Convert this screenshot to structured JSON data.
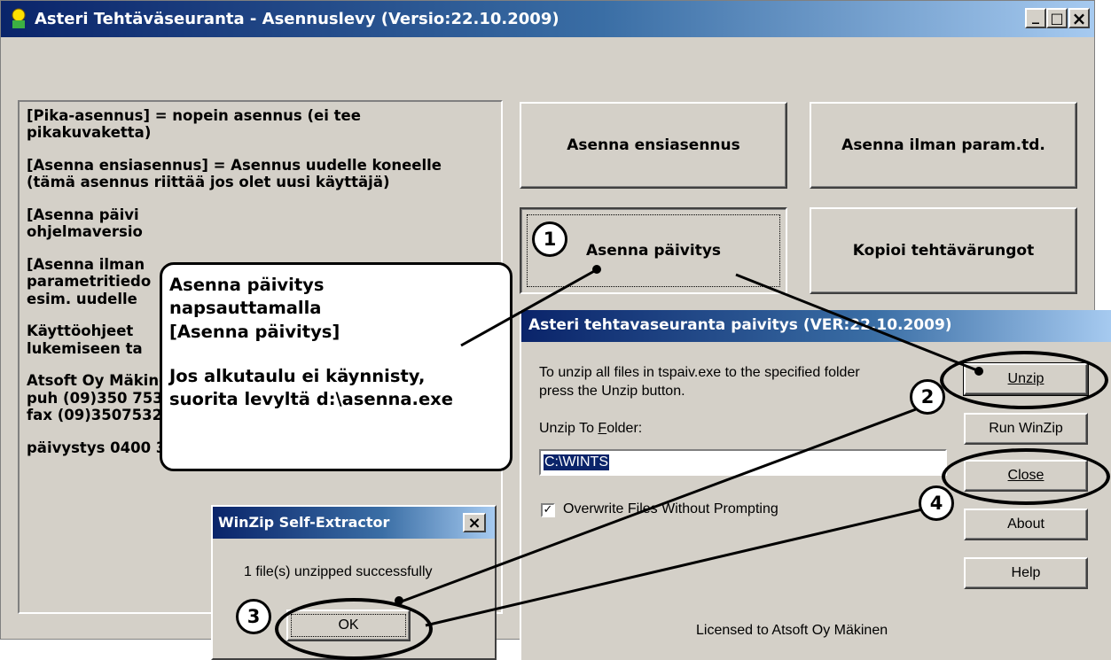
{
  "main_window": {
    "title": "Asteri Tehtäväseuranta - Asennuslevy (Versio:22.10.2009)"
  },
  "info_panel": {
    "lines": [
      "[Pika-asennus] = nopein asennus (ei tee pikakuvaketta)",
      "[Asenna ensiasennus] = Asennus uudelle koneelle (tämä asennus riittää jos olet uusi käyttäjä)",
      "[Asenna päivi",
      "ohjelmaversio",
      "[Asenna ilman",
      "parametritiedo",
      "esim. uudelle",
      "Käyttöohjeet",
      "lukemiseen ta",
      "Atsoft Oy Mäkinen - www.atsoft.fi",
      "puh (09)350 7530",
      "fax (09)35075321",
      "päivystys 0400 316"
    ]
  },
  "buttons": {
    "ensiasennus": "Asenna ensiasennus",
    "ilman_param": "Asenna ilman param.td.",
    "paivitys": "Asenna päivitys",
    "kopioi": "Kopioi tehtävärungot"
  },
  "callout": {
    "line1": "Asenna päivitys",
    "line2": "napsauttamalla",
    "line3": "[Asenna päivitys]",
    "line4": "Jos alkutaulu ei käynnisty,",
    "line5": "suorita levyltä d:\\asenna.exe"
  },
  "winzip": {
    "title": "Asteri tehtavaseuranta paivitys (VER:22.10.2009)",
    "instruction_1": "To unzip all files in tspaiv.exe to the specified folder",
    "instruction_2": "press the Unzip button.",
    "folder_label": "Unzip To Folder:",
    "folder_value": "C:\\WINTS",
    "overwrite_label": "Overwrite Files Without Prompting",
    "overwrite_checked": true,
    "btn_unzip": "Unzip",
    "btn_run_winzip": "Run WinZip",
    "btn_close": "Close",
    "btn_about": "About",
    "btn_help": "Help",
    "licensed": "Licensed to Atsoft Oy Mäkinen"
  },
  "sfx_dialog": {
    "title": "WinZip Self-Extractor",
    "message": "1 file(s) unzipped successfully",
    "ok": "OK",
    "close_glyph": "×"
  },
  "step_numbers": [
    "1",
    "2",
    "3",
    "4"
  ],
  "window_controls": {
    "minimize": "_",
    "maximize": "□",
    "close": "×"
  },
  "colors": {
    "title_blue": "#0a246a",
    "face": "#d4d0c8"
  }
}
